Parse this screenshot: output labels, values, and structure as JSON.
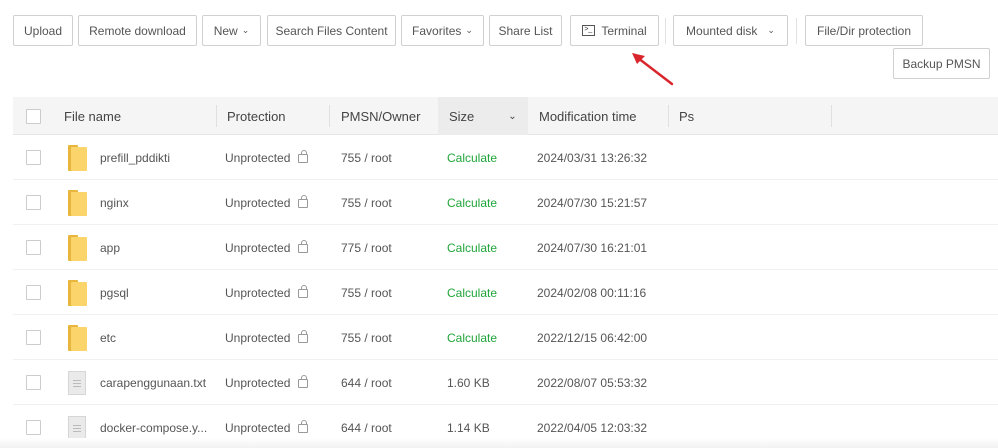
{
  "toolbar": {
    "upload": "Upload",
    "remote_download": "Remote download",
    "new": "New",
    "search_files_content": "Search Files Content",
    "favorites": "Favorites",
    "share_list": "Share List",
    "terminal": "Terminal",
    "mounted_disk": "Mounted disk",
    "file_dir_protection": "File/Dir protection",
    "backup_pmsn": "Backup PMSN"
  },
  "columns": {
    "file_name": "File name",
    "protection": "Protection",
    "pmsn_owner": "PMSN/Owner",
    "size": "Size",
    "modification_time": "Modification time",
    "ps": "Ps"
  },
  "rows": [
    {
      "type": "folder",
      "name": "prefill_pddikti",
      "protection": "Unprotected",
      "pmsn": "755 / root",
      "size": "Calculate",
      "mtime": "2024/03/31 13:26:32"
    },
    {
      "type": "folder",
      "name": "nginx",
      "protection": "Unprotected",
      "pmsn": "755 / root",
      "size": "Calculate",
      "mtime": "2024/07/30 15:21:57"
    },
    {
      "type": "folder",
      "name": "app",
      "protection": "Unprotected",
      "pmsn": "775 / root",
      "size": "Calculate",
      "mtime": "2024/07/30 16:21:01"
    },
    {
      "type": "folder",
      "name": "pgsql",
      "protection": "Unprotected",
      "pmsn": "755 / root",
      "size": "Calculate",
      "mtime": "2024/02/08 00:11:16"
    },
    {
      "type": "folder",
      "name": "etc",
      "protection": "Unprotected",
      "pmsn": "755 / root",
      "size": "Calculate",
      "mtime": "2022/12/15 06:42:00"
    },
    {
      "type": "file",
      "name": "carapenggunaan.txt",
      "protection": "Unprotected",
      "pmsn": "644 / root",
      "size": "1.60 KB",
      "mtime": "2022/08/07 05:53:32"
    },
    {
      "type": "file",
      "name": "docker-compose.y...",
      "protection": "Unprotected",
      "pmsn": "644 / root",
      "size": "1.14 KB",
      "mtime": "2022/04/05 12:03:32"
    }
  ],
  "colors": {
    "calculate": "#20a53a",
    "arrow": "#d9262c",
    "folder": "#fbd56b"
  }
}
